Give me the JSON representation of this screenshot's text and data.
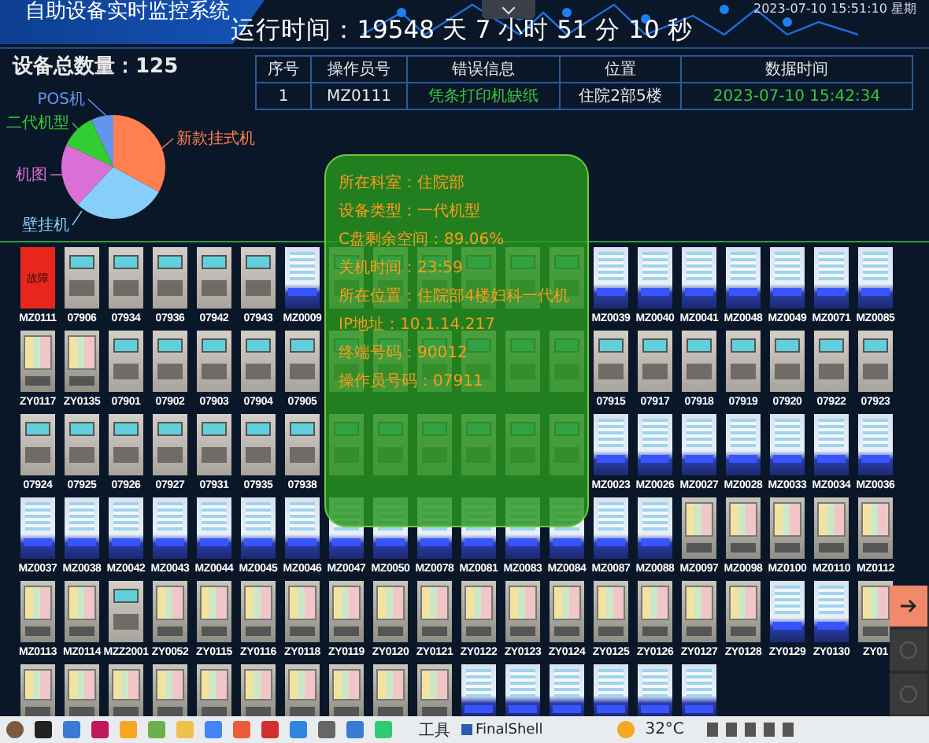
{
  "header": {
    "title": "自助设备实时监控系统",
    "runtime": "运行时间：19548 天 7 小时 51 分 10 秒",
    "datetime": "2023-07-10 15:51:10 星期"
  },
  "summary": {
    "total": "设备总数量：125"
  },
  "device_types": [
    {
      "label": "POS机",
      "color": "#6495ed"
    },
    {
      "label": "二代机型",
      "color": "#32cd32"
    },
    {
      "label": "新款挂式机",
      "color": "#ff7f50"
    },
    {
      "label": "机图",
      "color": "#da70d6"
    },
    {
      "label": "壁挂机",
      "color": "#87cefa"
    }
  ],
  "table": {
    "columns": [
      "序号",
      "操作员号",
      "错误信息",
      "位置",
      "数据时间"
    ],
    "rows": [
      {
        "cells": [
          "1",
          "MZ0111",
          "凭条打印机缺纸",
          "住院2部5楼",
          "2023-07-10 15:42:34"
        ],
        "alert": true
      }
    ]
  },
  "devices": [
    [
      {
        "kind": "fault",
        "label": "MZ0111",
        "badge": "故障"
      },
      {
        "kind": "classic",
        "label": "07906"
      },
      {
        "kind": "classic",
        "label": "07934"
      },
      {
        "kind": "classic",
        "label": "07936"
      },
      {
        "kind": "classic",
        "label": "07942"
      },
      {
        "kind": "classic",
        "label": "07943"
      },
      {
        "kind": "blue",
        "label": "MZ0009"
      },
      {
        "kind": "classic"
      },
      {
        "kind": "classic"
      },
      {
        "kind": "classic"
      },
      {
        "kind": "classic"
      },
      {
        "kind": "classic"
      },
      {
        "kind": "classic"
      },
      {
        "kind": "blue",
        "label": "MZ0039"
      },
      {
        "kind": "blue",
        "label": "MZ0040"
      },
      {
        "kind": "blue",
        "label": "MZ0041"
      },
      {
        "kind": "blue",
        "label": "MZ0048"
      },
      {
        "kind": "blue",
        "label": "MZ0049"
      },
      {
        "kind": "blue",
        "label": "MZ0071"
      },
      {
        "kind": "blue",
        "label": "MZ0085"
      }
    ],
    [
      {
        "kind": "touch",
        "label": "ZY0117"
      },
      {
        "kind": "touch",
        "label": "ZY0135"
      },
      {
        "kind": "classic",
        "label": "07901"
      },
      {
        "kind": "classic",
        "label": "07902"
      },
      {
        "kind": "classic",
        "label": "07903"
      },
      {
        "kind": "classic",
        "label": "07904"
      },
      {
        "kind": "classic",
        "label": "07905"
      },
      {
        "kind": "classic"
      },
      {
        "kind": "classic"
      },
      {
        "kind": "classic"
      },
      {
        "kind": "classic"
      },
      {
        "kind": "classic"
      },
      {
        "kind": "classic"
      },
      {
        "kind": "classic",
        "label": "07915"
      },
      {
        "kind": "classic",
        "label": "07917"
      },
      {
        "kind": "classic",
        "label": "07918"
      },
      {
        "kind": "classic",
        "label": "07919"
      },
      {
        "kind": "classic",
        "label": "07920"
      },
      {
        "kind": "classic",
        "label": "07922"
      },
      {
        "kind": "classic",
        "label": "07923"
      }
    ],
    [
      {
        "kind": "classic",
        "label": "07924"
      },
      {
        "kind": "classic",
        "label": "07925"
      },
      {
        "kind": "classic",
        "label": "07926"
      },
      {
        "kind": "classic",
        "label": "07927"
      },
      {
        "kind": "classic",
        "label": "07931"
      },
      {
        "kind": "classic",
        "label": "07935"
      },
      {
        "kind": "classic",
        "label": "07938"
      },
      {
        "kind": "classic"
      },
      {
        "kind": "classic"
      },
      {
        "kind": "classic"
      },
      {
        "kind": "classic"
      },
      {
        "kind": "classic"
      },
      {
        "kind": "classic"
      },
      {
        "kind": "blue",
        "label": "MZ0023"
      },
      {
        "kind": "blue",
        "label": "MZ0026"
      },
      {
        "kind": "blue",
        "label": "MZ0027"
      },
      {
        "kind": "blue",
        "label": "MZ0028"
      },
      {
        "kind": "blue",
        "label": "MZ0033"
      },
      {
        "kind": "blue",
        "label": "MZ0034"
      },
      {
        "kind": "blue",
        "label": "MZ0036"
      }
    ],
    [
      {
        "kind": "blue",
        "label": "MZ0037"
      },
      {
        "kind": "blue",
        "label": "MZ0038"
      },
      {
        "kind": "blue",
        "label": "MZ0042"
      },
      {
        "kind": "blue",
        "label": "MZ0043"
      },
      {
        "kind": "blue",
        "label": "MZ0044"
      },
      {
        "kind": "blue",
        "label": "MZ0045"
      },
      {
        "kind": "blue",
        "label": "MZ0046"
      },
      {
        "kind": "blue",
        "label": "MZ0047"
      },
      {
        "kind": "blue",
        "label": "MZ0050"
      },
      {
        "kind": "blue",
        "label": "MZ0078"
      },
      {
        "kind": "blue",
        "label": "MZ0081"
      },
      {
        "kind": "blue",
        "label": "MZ0083"
      },
      {
        "kind": "blue",
        "label": "MZ0084"
      },
      {
        "kind": "blue",
        "label": "MZ0087"
      },
      {
        "kind": "blue",
        "label": "MZ0088"
      },
      {
        "kind": "touch",
        "label": "MZ0097"
      },
      {
        "kind": "touch",
        "label": "MZ0098"
      },
      {
        "kind": "touch",
        "label": "MZ0100"
      },
      {
        "kind": "touch",
        "label": "MZ0110"
      },
      {
        "kind": "touch",
        "label": "MZ0112"
      }
    ],
    [
      {
        "kind": "touch",
        "label": "MZ0113"
      },
      {
        "kind": "touch",
        "label": "MZ0114"
      },
      {
        "kind": "classic",
        "label": "MZZ2001"
      },
      {
        "kind": "touch",
        "label": "ZY0052"
      },
      {
        "kind": "touch",
        "label": "ZY0115"
      },
      {
        "kind": "touch",
        "label": "ZY0116"
      },
      {
        "kind": "touch",
        "label": "ZY0118"
      },
      {
        "kind": "touch",
        "label": "ZY0119"
      },
      {
        "kind": "touch",
        "label": "ZY0120"
      },
      {
        "kind": "touch",
        "label": "ZY0121"
      },
      {
        "kind": "touch",
        "label": "ZY0122"
      },
      {
        "kind": "touch",
        "label": "ZY0123"
      },
      {
        "kind": "touch",
        "label": "ZY0124"
      },
      {
        "kind": "touch",
        "label": "ZY0125"
      },
      {
        "kind": "touch",
        "label": "ZY0126"
      },
      {
        "kind": "touch",
        "label": "ZY0127"
      },
      {
        "kind": "touch",
        "label": "ZY0128"
      },
      {
        "kind": "blue",
        "label": "ZY0129"
      },
      {
        "kind": "blue",
        "label": "ZY0130"
      },
      {
        "kind": "touch",
        "label": "ZY01"
      }
    ],
    [
      {
        "kind": "touch"
      },
      {
        "kind": "touch"
      },
      {
        "kind": "touch"
      },
      {
        "kind": "touch"
      },
      {
        "kind": "touch"
      },
      {
        "kind": "touch"
      },
      {
        "kind": "touch"
      },
      {
        "kind": "touch"
      },
      {
        "kind": "touch"
      },
      {
        "kind": "touch"
      },
      {
        "kind": "blue"
      },
      {
        "kind": "blue"
      },
      {
        "kind": "blue"
      },
      {
        "kind": "blue"
      },
      {
        "kind": "blue"
      },
      {
        "kind": "blue"
      }
    ]
  ],
  "tooltip": {
    "lines": [
      "所在科室：住院部",
      "设备类型：一代机型",
      "C盘剩余空间：89.06%",
      "关机时间：23:59",
      "所在位置：住院部4楼妇科一代机",
      "IP地址：10.1.14.217",
      "终端号码：90012",
      "操作员号码：07911"
    ]
  },
  "side_panel": {
    "buttons": [
      {
        "kind": "arrow",
        "selected": true
      },
      {
        "kind": "link",
        "selected": false
      },
      {
        "kind": "link",
        "selected": false
      }
    ]
  },
  "taskbar": {
    "apps": [
      {
        "kind": "avatar"
      },
      {
        "kind": "terminal"
      },
      {
        "kind": "window"
      },
      {
        "kind": "ide"
      },
      {
        "kind": "paint"
      },
      {
        "kind": "android"
      },
      {
        "kind": "folder"
      },
      {
        "kind": "browser"
      },
      {
        "kind": "media"
      },
      {
        "kind": "office"
      },
      {
        "kind": "remote"
      },
      {
        "kind": "text"
      },
      {
        "kind": "window"
      },
      {
        "kind": "chat"
      }
    ],
    "tools_label": "工具",
    "active_app": "FinalShell",
    "weather": "32°C"
  }
}
